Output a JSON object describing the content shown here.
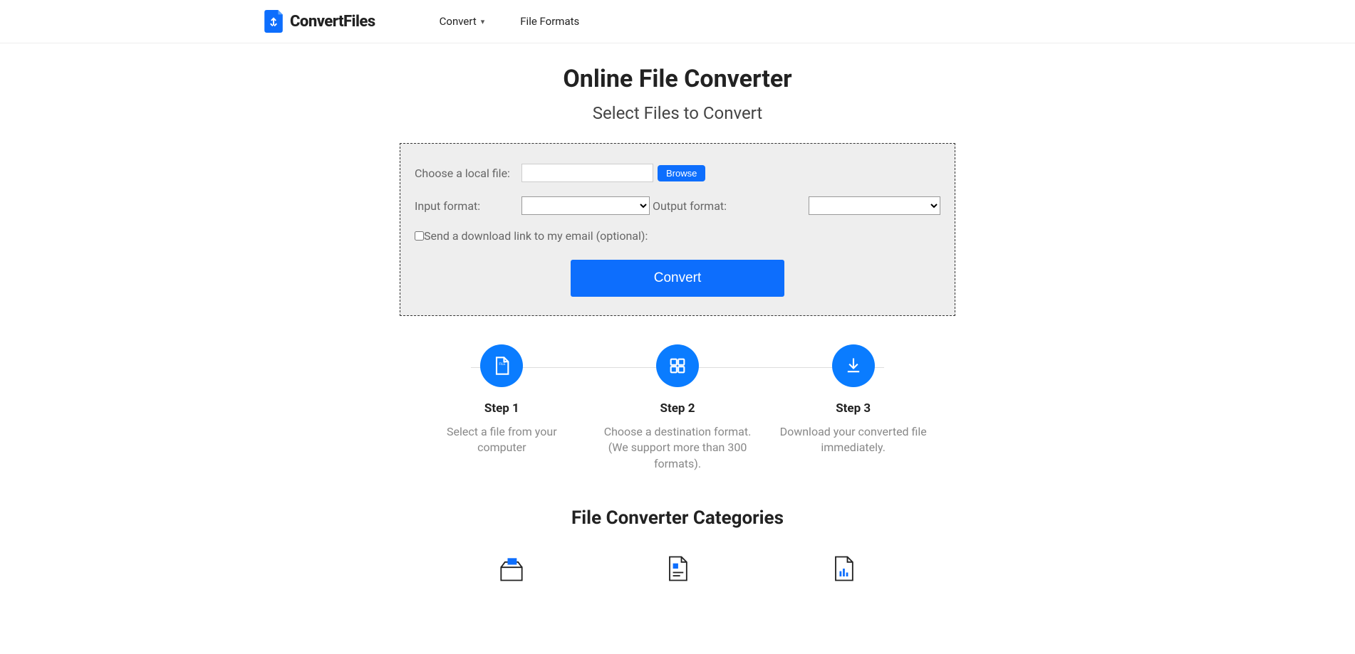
{
  "header": {
    "brand": "ConvertFiles",
    "nav": {
      "convert": "Convert",
      "file_formats": "File Formats"
    }
  },
  "main": {
    "title": "Online File Converter",
    "subtitle": "Select Files to Convert"
  },
  "form": {
    "choose_label": "Choose a local file:",
    "file_value": "",
    "browse_label": "Browse",
    "input_format_label": "Input format:",
    "input_format_value": "",
    "output_format_label": "Output format:",
    "output_format_value": "",
    "email_label": "Send a download link to my email (optional):",
    "convert_label": "Convert"
  },
  "steps": [
    {
      "title": "Step 1",
      "desc": "Select a file from your computer"
    },
    {
      "title": "Step 2",
      "desc": "Choose a destination format. (We support more than 300 formats)."
    },
    {
      "title": "Step 3",
      "desc": "Download your converted file immediately."
    }
  ],
  "categories": {
    "title": "File Converter Categories"
  }
}
